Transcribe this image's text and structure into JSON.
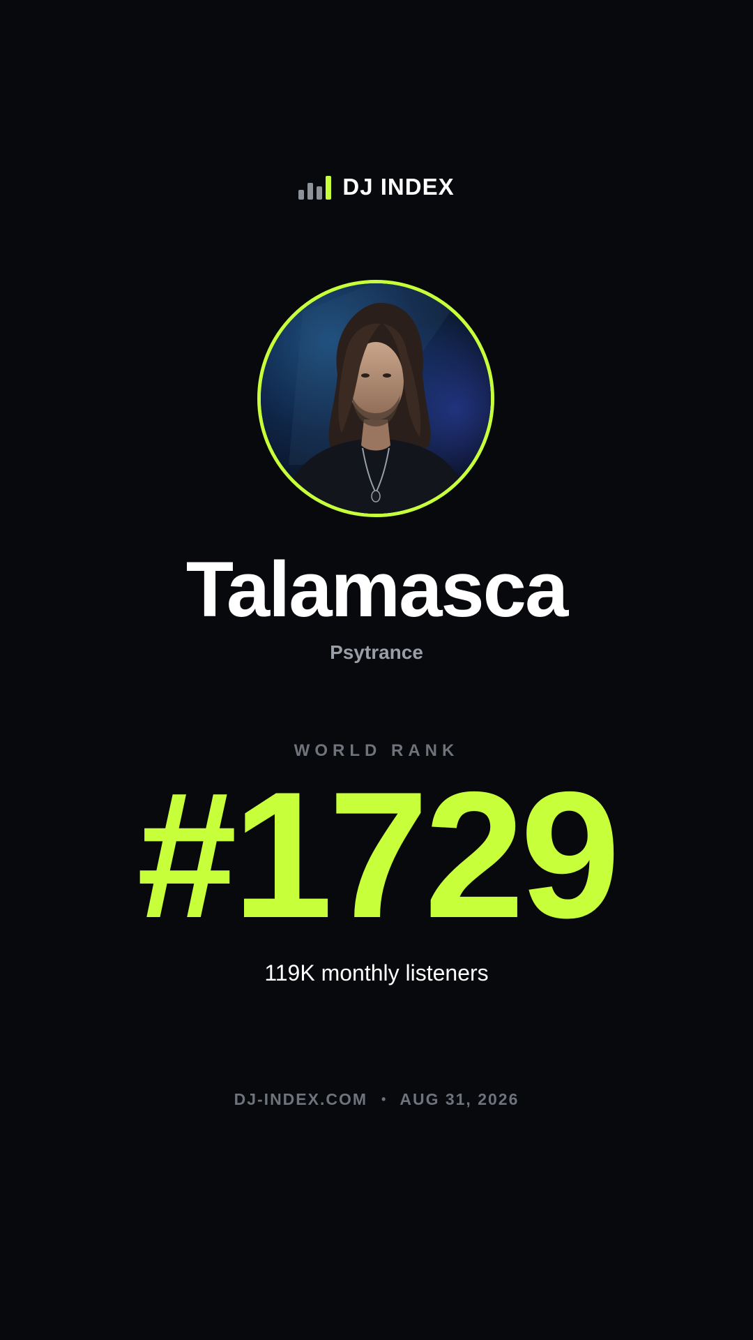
{
  "brand": {
    "icon": "bar-chart-icon",
    "name": "DJ INDEX",
    "accent_color": "#c8ff3b"
  },
  "artist": {
    "photo": "artist-portrait-image",
    "name": "Talamasca",
    "genre": "Psytrance"
  },
  "rank": {
    "label": "WORLD RANK",
    "value": "#1729"
  },
  "stats": {
    "listeners": "119K monthly listeners"
  },
  "footer": {
    "site": "DJ-INDEX.COM",
    "separator": "•",
    "date": "AUG 31, 2026"
  },
  "colors": {
    "background": "#08090c",
    "accent": "#c8ff3b",
    "muted_text": "#6f737c",
    "secondary_text": "#9a9ea6"
  }
}
